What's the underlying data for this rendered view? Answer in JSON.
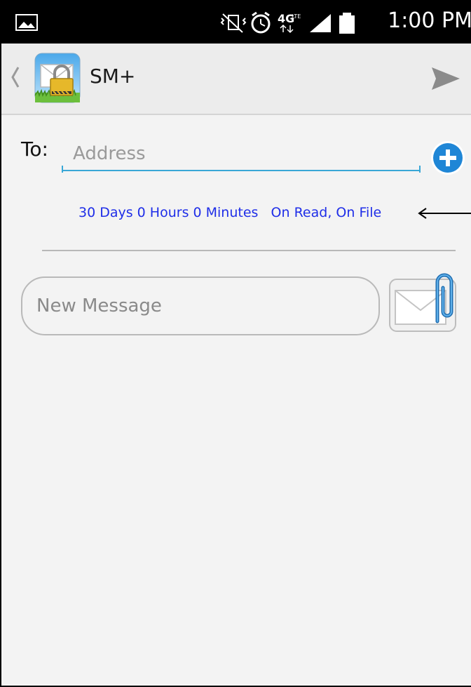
{
  "status_bar": {
    "time": "1:00 PM",
    "icons": [
      "gallery-icon",
      "mute-icon",
      "alarm-icon",
      "4g-lte-icon",
      "signal-icon",
      "battery-icon"
    ]
  },
  "action_bar": {
    "app_title": "SM+",
    "icons": [
      "back-chevron-icon",
      "app-lock-icon",
      "send-icon"
    ]
  },
  "compose": {
    "to_label": "To:",
    "address_placeholder": "Address",
    "expiry_text": "30 Days 0 Hours 0 Minutes   On Read, On File",
    "message_placeholder": "New Message"
  },
  "colors": {
    "accent_blue": "#39a7d6",
    "expiry_text": "#1f2ee8",
    "add_button": "#1f86d6"
  }
}
